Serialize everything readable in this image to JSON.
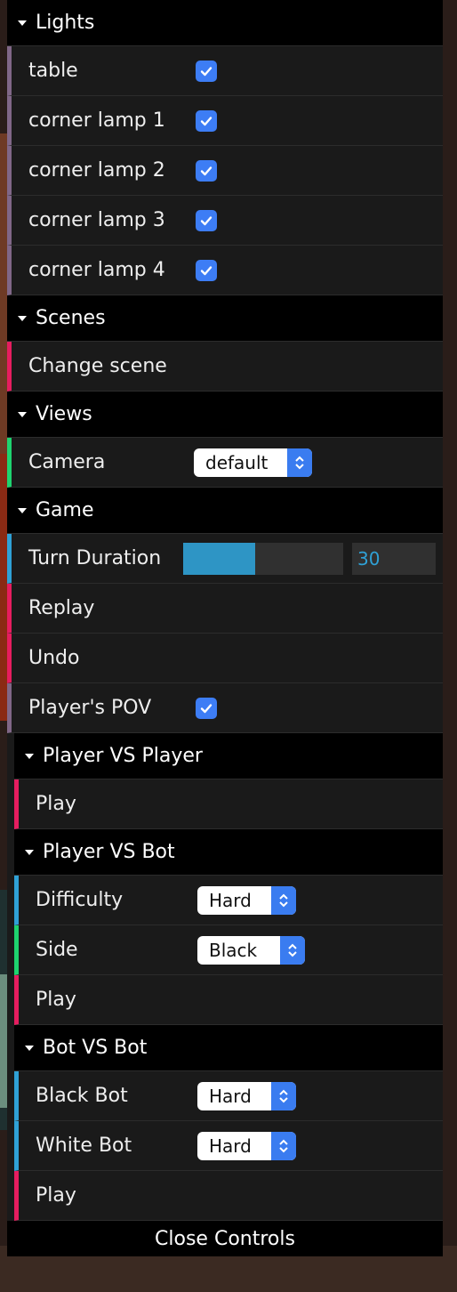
{
  "lights": {
    "title": "Lights",
    "items": [
      {
        "label": "table",
        "checked": true
      },
      {
        "label": "corner lamp 1",
        "checked": true
      },
      {
        "label": "corner lamp 2",
        "checked": true
      },
      {
        "label": "corner lamp 3",
        "checked": true
      },
      {
        "label": "corner lamp 4",
        "checked": true
      }
    ]
  },
  "scenes": {
    "title": "Scenes",
    "change_scene": "Change scene"
  },
  "views": {
    "title": "Views",
    "camera_label": "Camera",
    "camera_value": "default"
  },
  "game": {
    "title": "Game",
    "turn_duration_label": "Turn Duration",
    "turn_duration_value": "30",
    "turn_duration_fill": 0.45,
    "replay": "Replay",
    "undo": "Undo",
    "pov_label": "Player's POV",
    "pov_checked": true,
    "pvp": {
      "title": "Player VS Player",
      "play": "Play"
    },
    "pvb": {
      "title": "Player VS Bot",
      "difficulty_label": "Difficulty",
      "difficulty_value": "Hard",
      "side_label": "Side",
      "side_value": "Black",
      "play": "Play"
    },
    "bvb": {
      "title": "Bot VS Bot",
      "black_bot_label": "Black Bot",
      "black_bot_value": "Hard",
      "white_bot_label": "White Bot",
      "white_bot_value": "Hard",
      "play": "Play"
    }
  },
  "close_controls": "Close Controls",
  "colors": {
    "accent": "#2fa1d6",
    "function": "#e61d5f",
    "boolean": "#806787",
    "string": "#1ed36f",
    "checkbox": "#3d7df5"
  }
}
